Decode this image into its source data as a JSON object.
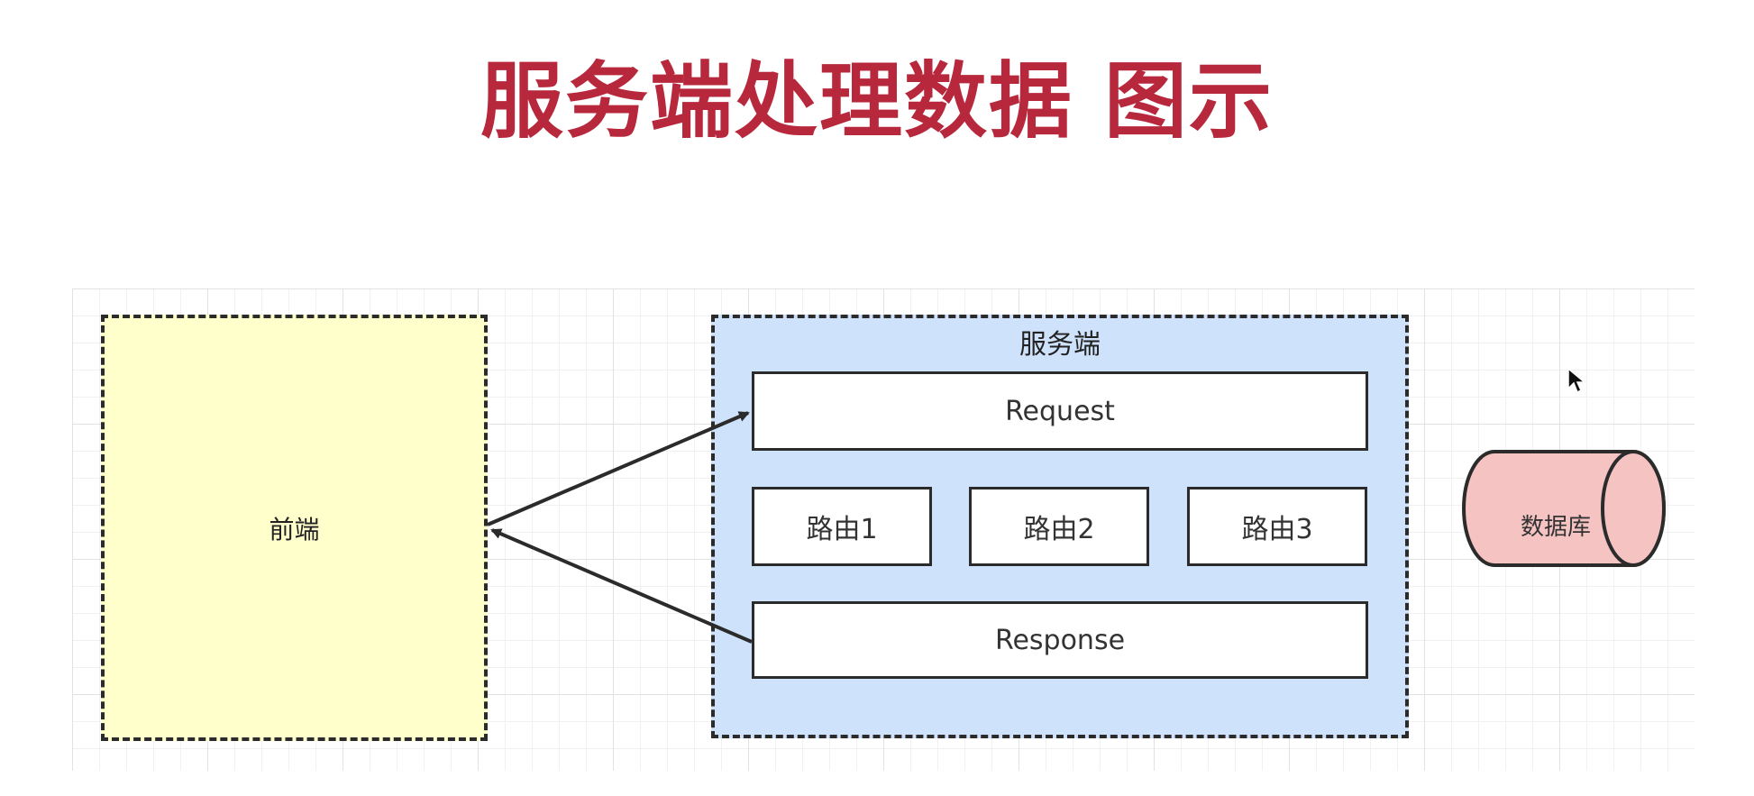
{
  "title": "服务端处理数据 图示",
  "colors": {
    "title": "#b7283c",
    "frontend_fill": "#ffffcc",
    "server_fill": "#cfe2fb",
    "database_fill": "#f6c3c3",
    "line": "#2b2b2b"
  },
  "frontend": {
    "label": "前端"
  },
  "server": {
    "label": "服务端",
    "request_label": "Request",
    "routes": [
      "路由1",
      "路由2",
      "路由3"
    ],
    "response_label": "Response"
  },
  "database": {
    "label": "数据库"
  },
  "icons": {
    "cursor": "mouse-pointer-icon"
  }
}
